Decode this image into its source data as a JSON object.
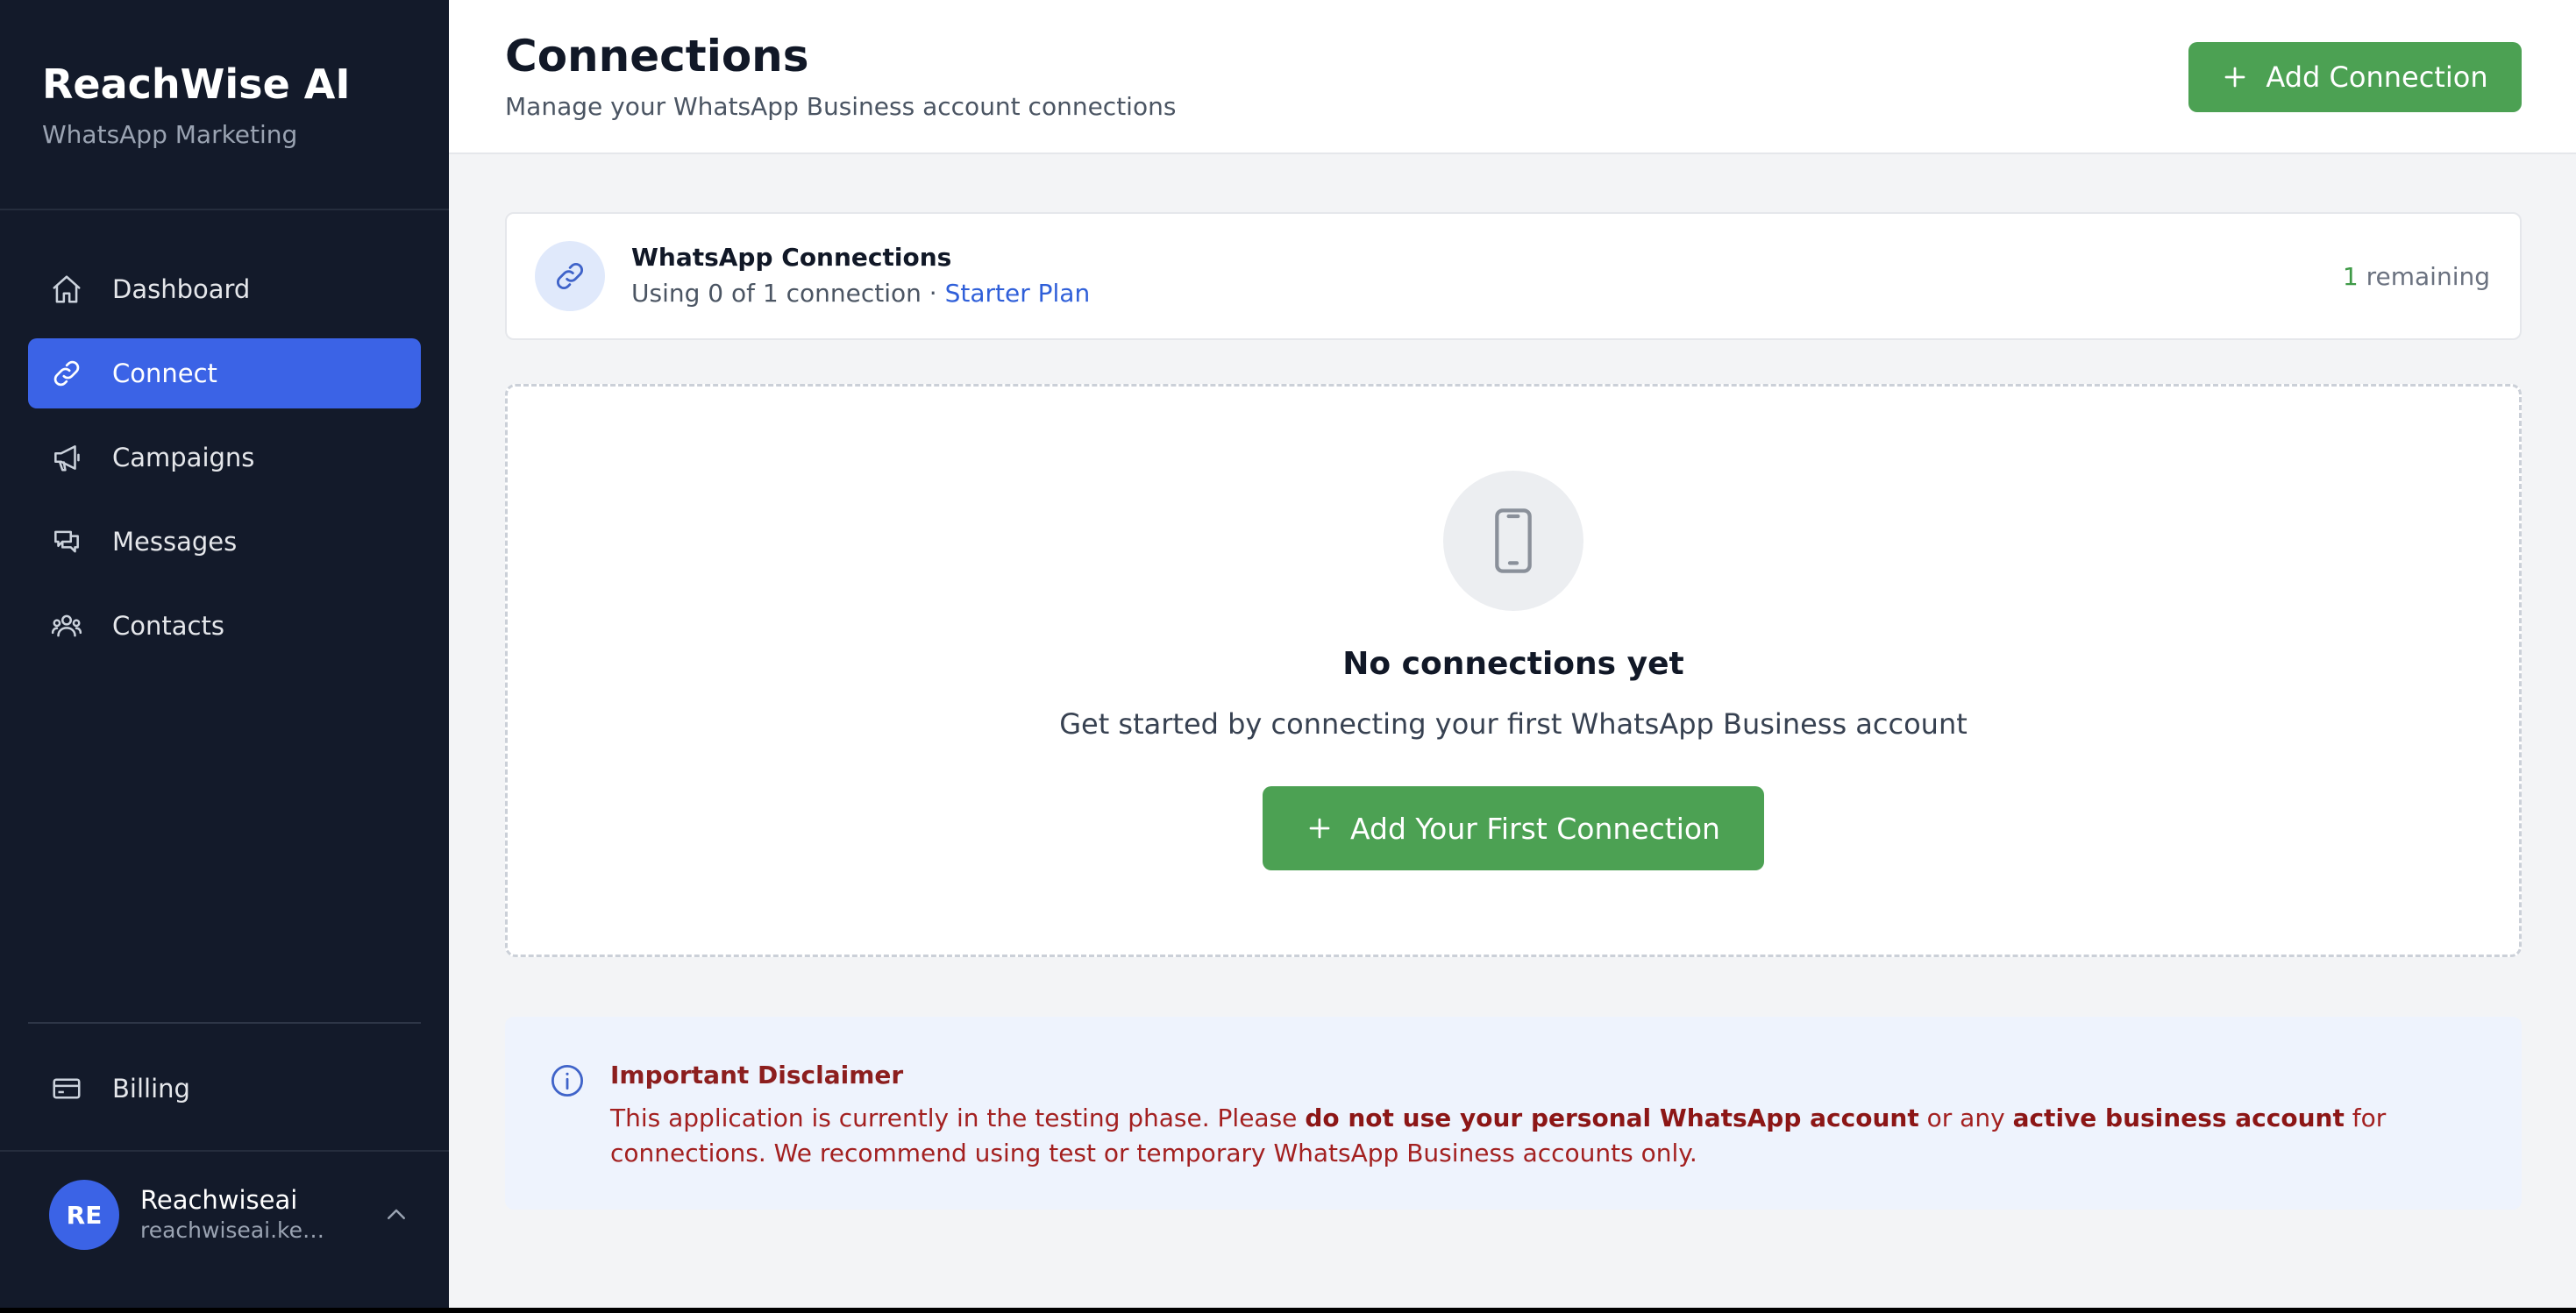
{
  "sidebar": {
    "brand_title": "ReachWise AI",
    "brand_subtitle": "WhatsApp Marketing",
    "nav": [
      {
        "label": "Dashboard",
        "icon": "home-icon",
        "active": false
      },
      {
        "label": "Connect",
        "icon": "link-icon",
        "active": true
      },
      {
        "label": "Campaigns",
        "icon": "megaphone-icon",
        "active": false
      },
      {
        "label": "Messages",
        "icon": "chat-icon",
        "active": false
      },
      {
        "label": "Contacts",
        "icon": "users-icon",
        "active": false
      }
    ],
    "billing_label": "Billing",
    "user": {
      "initials": "RE",
      "name": "Reachwiseai",
      "email": "reachwiseai.ke@g..."
    }
  },
  "header": {
    "title": "Connections",
    "subtitle": "Manage your WhatsApp Business account connections",
    "add_button": "Add Connection"
  },
  "summary_card": {
    "title": "WhatsApp Connections",
    "usage_text": "Using 0 of 1 connection · ",
    "plan": "Starter Plan",
    "remaining_count": "1",
    "remaining_label": " remaining"
  },
  "empty_state": {
    "title": "No connections yet",
    "subtitle": "Get started by connecting your first WhatsApp Business account",
    "button": "Add Your First Connection"
  },
  "disclaimer": {
    "title": "Important Disclaimer",
    "text_1": "This application is currently in the testing phase. Please ",
    "bold_1": "do not use your personal WhatsApp account",
    "text_2": " or any ",
    "bold_2": "active business account",
    "text_3": " for connections. We recommend using test or temporary WhatsApp Business accounts only."
  },
  "colors": {
    "sidebar_bg": "#131a2a",
    "accent_blue": "#3b63e6",
    "button_green": "#4ca153",
    "disclaimer_red": "#a32020"
  }
}
